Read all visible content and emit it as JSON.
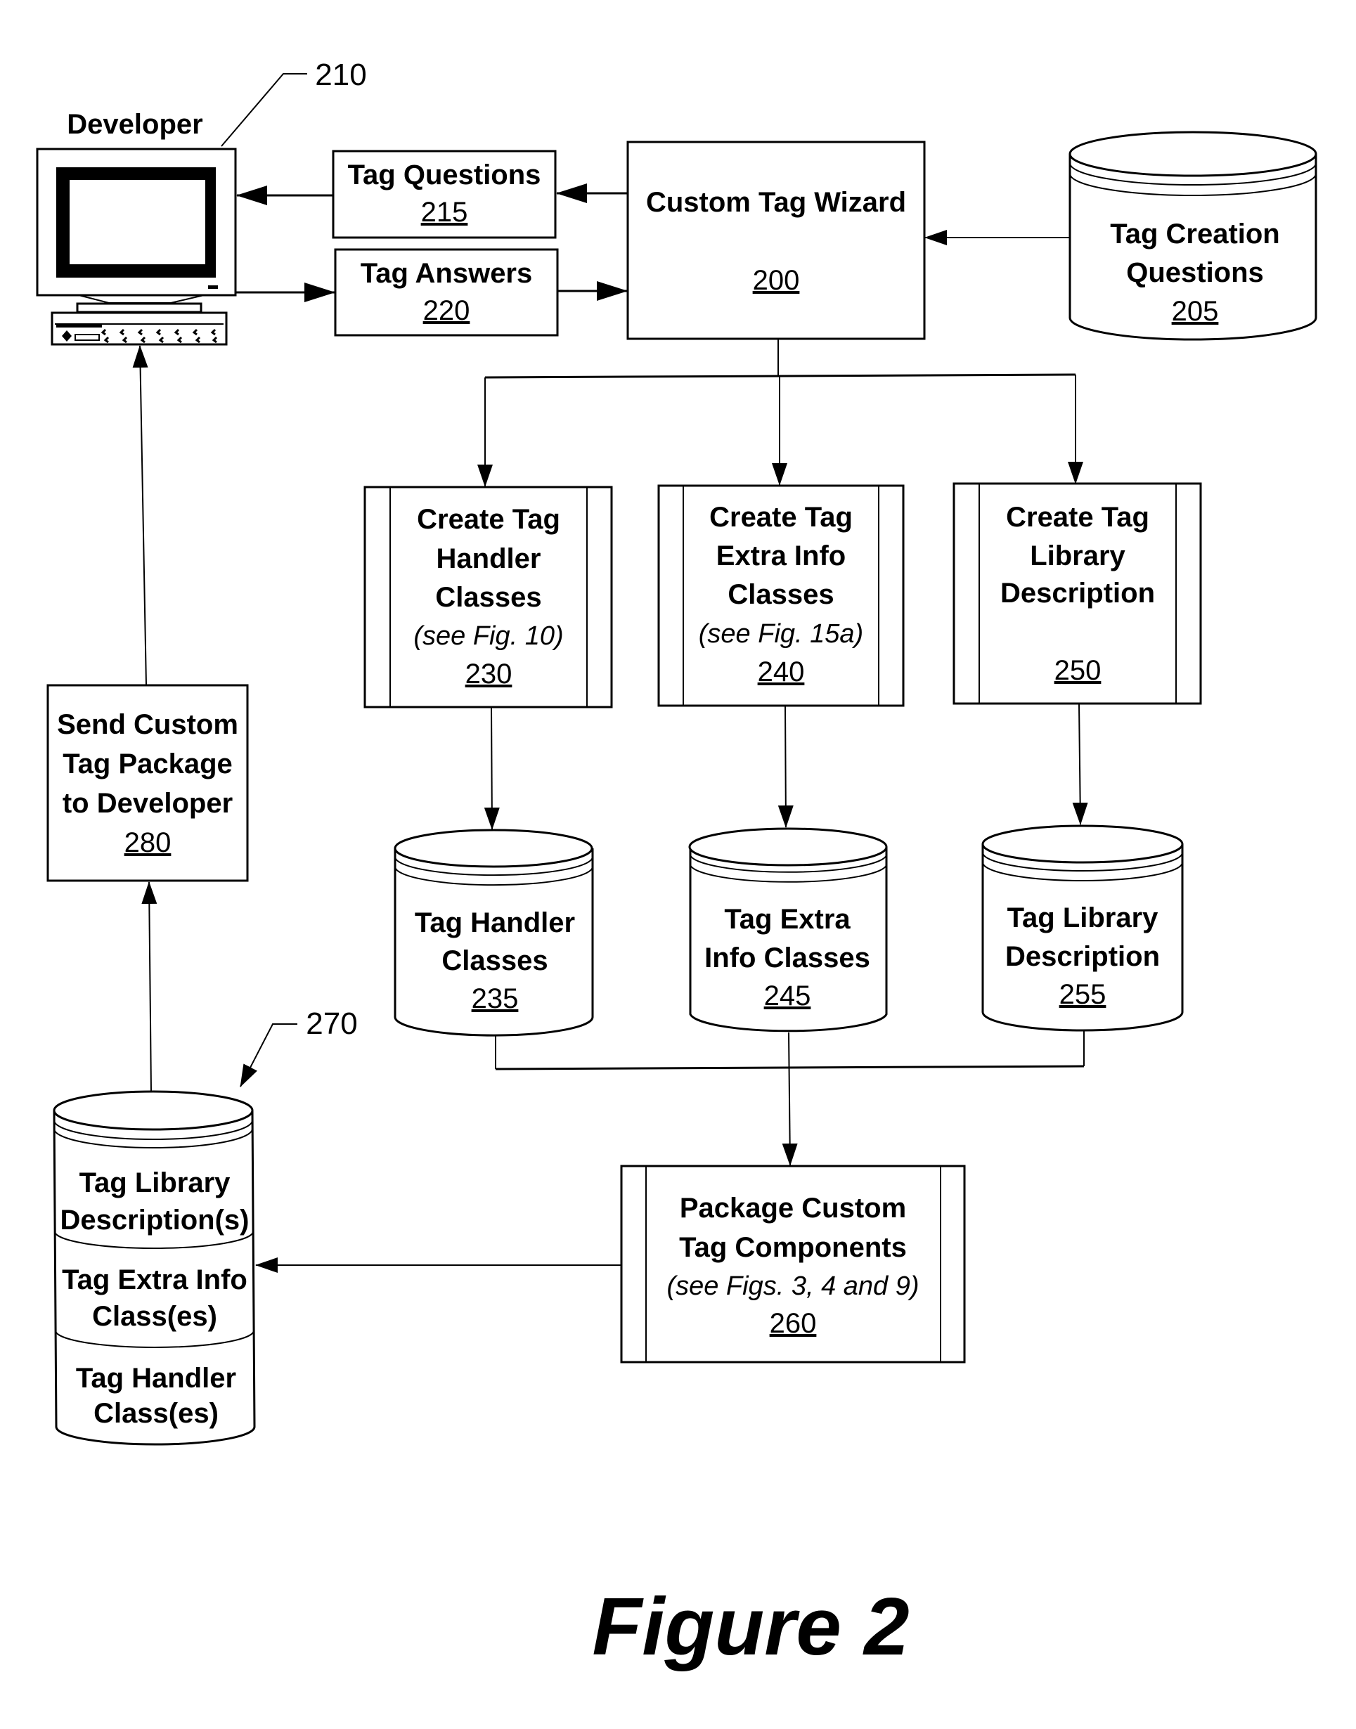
{
  "figure": {
    "caption": "Figure 2",
    "colors": {
      "ink": "#000000",
      "paper": "#ffffff"
    }
  },
  "developer": {
    "label": "Developer",
    "ref": "210",
    "icon": "computer-workstation-icon"
  },
  "tag_questions": {
    "lines": [
      "Tag Questions"
    ],
    "ref": "215"
  },
  "tag_answers": {
    "lines": [
      "Tag Answers"
    ],
    "ref": "220"
  },
  "wizard": {
    "lines": [
      "Custom Tag Wizard"
    ],
    "ref": "200"
  },
  "tag_creation_questions": {
    "lines": [
      "Tag Creation",
      "Questions"
    ],
    "ref": "205",
    "shape": "database-cylinder"
  },
  "processes": [
    {
      "id": "create-tag-handler-classes",
      "lines": [
        "Create Tag",
        "Handler",
        "Classes"
      ],
      "note": "(see Fig. 10)",
      "ref": "230"
    },
    {
      "id": "create-tag-extra-info-classes",
      "lines": [
        "Create Tag",
        "Extra Info",
        "Classes"
      ],
      "note": "(see Fig. 15a)",
      "ref": "240"
    },
    {
      "id": "create-tag-library-description",
      "lines": [
        "Create Tag",
        "Library",
        "Description"
      ],
      "note": "",
      "ref": "250"
    }
  ],
  "stores": [
    {
      "id": "tag-handler-classes",
      "lines": [
        "Tag Handler",
        "Classes"
      ],
      "ref": "235"
    },
    {
      "id": "tag-extra-info-classes",
      "lines": [
        "Tag Extra",
        "Info Classes"
      ],
      "ref": "245"
    },
    {
      "id": "tag-library-description",
      "lines": [
        "Tag Library",
        "Description"
      ],
      "ref": "255"
    }
  ],
  "package": {
    "lines": [
      "Package Custom",
      "Tag Components"
    ],
    "note": "(see Figs. 3, 4 and 9)",
    "ref": "260"
  },
  "custom_tag_package": {
    "ref": "270",
    "sections": [
      {
        "lines": [
          "Tag Library",
          "Description(s)"
        ]
      },
      {
        "lines": [
          "Tag Extra Info",
          "Class(es)"
        ]
      },
      {
        "lines": [
          "Tag Handler",
          "Class(es)"
        ]
      }
    ]
  },
  "send": {
    "lines": [
      "Send Custom",
      "Tag Package",
      "to Developer"
    ],
    "ref": "280"
  },
  "edges": [
    {
      "from": "200",
      "to": "215"
    },
    {
      "from": "215",
      "to": "210"
    },
    {
      "from": "210",
      "to": "220"
    },
    {
      "from": "220",
      "to": "200"
    },
    {
      "from": "205",
      "to": "200"
    },
    {
      "from": "200",
      "to": "230"
    },
    {
      "from": "200",
      "to": "240"
    },
    {
      "from": "200",
      "to": "250"
    },
    {
      "from": "230",
      "to": "235"
    },
    {
      "from": "240",
      "to": "245"
    },
    {
      "from": "250",
      "to": "255"
    },
    {
      "from": "235",
      "to": "260"
    },
    {
      "from": "245",
      "to": "260"
    },
    {
      "from": "255",
      "to": "260"
    },
    {
      "from": "260",
      "to": "270"
    },
    {
      "from": "270",
      "to": "280"
    },
    {
      "from": "280",
      "to": "210"
    }
  ]
}
